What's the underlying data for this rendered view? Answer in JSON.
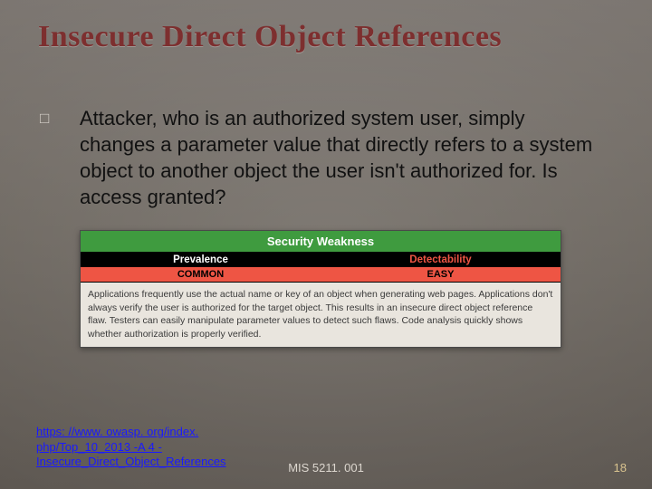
{
  "title": "Insecure Direct Object References",
  "bullet_glyph": "□",
  "body_text": "Attacker, who is an authorized system user, simply changes a parameter value that directly refers to a system object to another object the user isn't authorized for. Is access granted?",
  "table": {
    "heading": "Security Weakness",
    "col_prevalence": "Prevalence",
    "col_detectability": "Detectability",
    "val_prevalence": "COMMON",
    "val_detectability": "EASY",
    "description": "Applications frequently use the actual name or key of an object when generating web pages. Applications don't always verify the user is authorized for the target object. This results in an insecure direct object reference flaw. Testers can easily manipulate parameter values to detect such flaws. Code analysis quickly shows whether authorization is properly verified."
  },
  "citation_text": "https: //www. owasp. org/index. php/Top_10_2013 -A 4 -Insecure_Direct_Object_References",
  "course_code": "MIS 5211. 001",
  "page_number": "18"
}
